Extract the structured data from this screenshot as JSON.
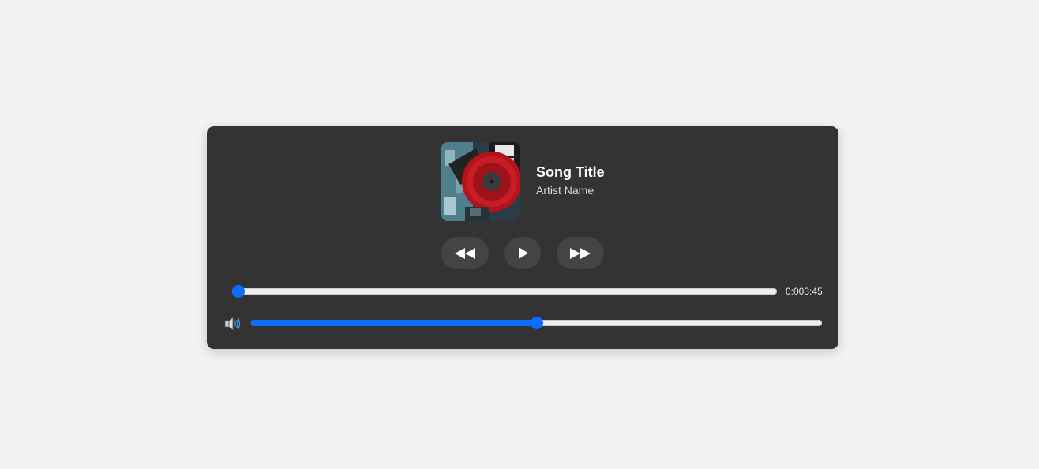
{
  "track": {
    "title": "Song Title",
    "artist": "Artist Name",
    "album_art_icon": "vinyl-record-album-art"
  },
  "controls": {
    "rewind_icon": "rewind-icon",
    "play_icon": "play-icon",
    "forward_icon": "fast-forward-icon"
  },
  "progress": {
    "time_text": "0:003:45",
    "value_fraction": 0.0
  },
  "volume": {
    "icon": "speaker-volume-icon",
    "value_fraction": 0.5
  },
  "colors": {
    "accent": "#0d6efd",
    "player_background": "#333333",
    "button_background": "#444444",
    "page_background": "#f2f2f2"
  }
}
